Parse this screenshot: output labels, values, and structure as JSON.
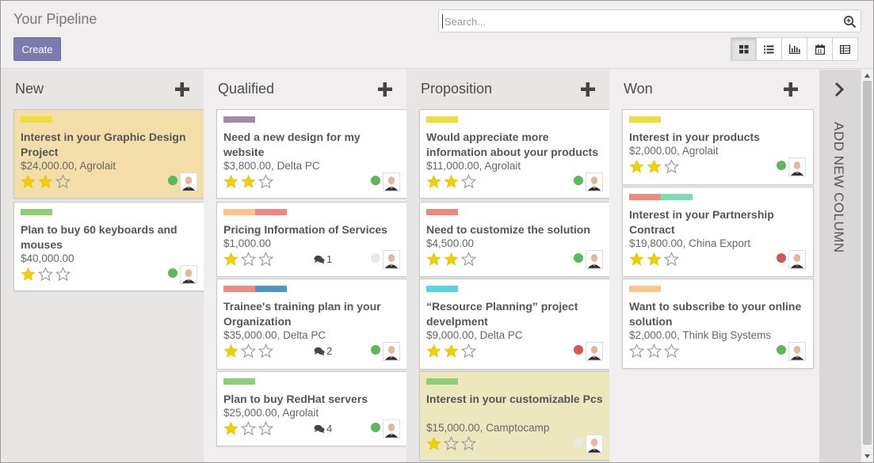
{
  "header": {
    "title": "Your Pipeline",
    "create_label": "Create",
    "search_placeholder": "Search..."
  },
  "view_switcher": [
    {
      "icon": "kanban-view-icon",
      "active": true
    },
    {
      "icon": "list-view-icon",
      "active": false
    },
    {
      "icon": "graph-view-icon",
      "active": false
    },
    {
      "icon": "calendar-view-icon",
      "active": false
    },
    {
      "icon": "pivot-view-icon",
      "active": false
    }
  ],
  "colors": {
    "yellow": "#f0dd3c",
    "green": "#8dce76",
    "purple": "#a58aa5",
    "orange": "#fbc58e",
    "red": "#ec8a7f",
    "blue": "#4d95c6",
    "cyan": "#52d6e6",
    "teal": "#7ddcb1",
    "dot_green": "#5cb85c",
    "dot_red": "#d9534f",
    "dot_grey": "#e8e8e8",
    "star_filled": "#f3cf00",
    "primary": "#7c7bad"
  },
  "columns": [
    {
      "title": "New",
      "cards": [
        {
          "title": "Interest in your Graphic Design Project",
          "amount": "$24,000.00",
          "company": "Agrolait",
          "stars": 2,
          "tags": [
            "yellow"
          ],
          "bg": "orange",
          "status": "green",
          "messages": ""
        },
        {
          "title": "Plan to buy 60 keyboards and mouses",
          "amount": "$40,000.00",
          "company": "",
          "stars": 1,
          "tags": [
            "green"
          ],
          "bg": "",
          "status": "green",
          "messages": ""
        }
      ]
    },
    {
      "title": "Qualified",
      "cards": [
        {
          "title": "Need a new design for my website",
          "amount": "$3,800.00",
          "company": "Delta PC",
          "stars": 2,
          "tags": [
            "purple"
          ],
          "bg": "",
          "status": "green",
          "messages": ""
        },
        {
          "title": "Pricing Information of Services",
          "amount": "$1,000.00",
          "company": "",
          "stars": 1,
          "tags": [
            "orange",
            "red"
          ],
          "bg": "",
          "status": "grey",
          "messages": "1"
        },
        {
          "title": "Trainee's training plan in your Organization",
          "amount": "$35,000.00",
          "company": "Delta PC",
          "stars": 1,
          "tags": [
            "red",
            "blue"
          ],
          "bg": "",
          "status": "green",
          "messages": "2"
        },
        {
          "title": "Plan to buy RedHat servers",
          "amount": "$25,000.00",
          "company": "Agrolait",
          "stars": 1,
          "tags": [
            "green"
          ],
          "bg": "",
          "status": "green",
          "messages": "4"
        }
      ]
    },
    {
      "title": "Proposition",
      "cards": [
        {
          "title": "Would appreciate more information about your products",
          "amount": "$11,000.00",
          "company": "Agrolait",
          "stars": 2,
          "tags": [
            "yellow"
          ],
          "bg": "",
          "status": "green",
          "messages": ""
        },
        {
          "title": "Need to customize the solution",
          "amount": "$4,500.00",
          "company": "",
          "stars": 2,
          "tags": [
            "red"
          ],
          "bg": "",
          "status": "green",
          "messages": ""
        },
        {
          "title": "“Resource Planning” project develpment",
          "amount": "$9,000.00",
          "company": "Delta PC",
          "stars": 2,
          "tags": [
            "cyan"
          ],
          "bg": "",
          "status": "red",
          "messages": ""
        },
        {
          "title": "Interest in your customizable Pcs",
          "amount": "$15,000.00",
          "company": "Camptocamp",
          "stars": 1,
          "tags": [
            "green"
          ],
          "bg": "yellow",
          "status": "grey",
          "messages": ""
        }
      ]
    },
    {
      "title": "Won",
      "cards": [
        {
          "title": "Interest in your products",
          "amount": "$2,000.00",
          "company": "Agrolait",
          "stars": 2,
          "tags": [
            "yellow"
          ],
          "bg": "",
          "status": "green",
          "messages": ""
        },
        {
          "title": "Interest in your Partnership Contract",
          "amount": "$19,800.00",
          "company": "China Export",
          "stars": 2,
          "tags": [
            "red",
            "teal"
          ],
          "bg": "",
          "status": "red",
          "messages": ""
        },
        {
          "title": "Want to subscribe to your online solution",
          "amount": "$2,000.00",
          "company": "Think Big Systems",
          "stars": 0,
          "tags": [
            "orange"
          ],
          "bg": "",
          "status": "green",
          "messages": ""
        }
      ]
    }
  ],
  "add_column_label": "ADD NEW COLUMN"
}
